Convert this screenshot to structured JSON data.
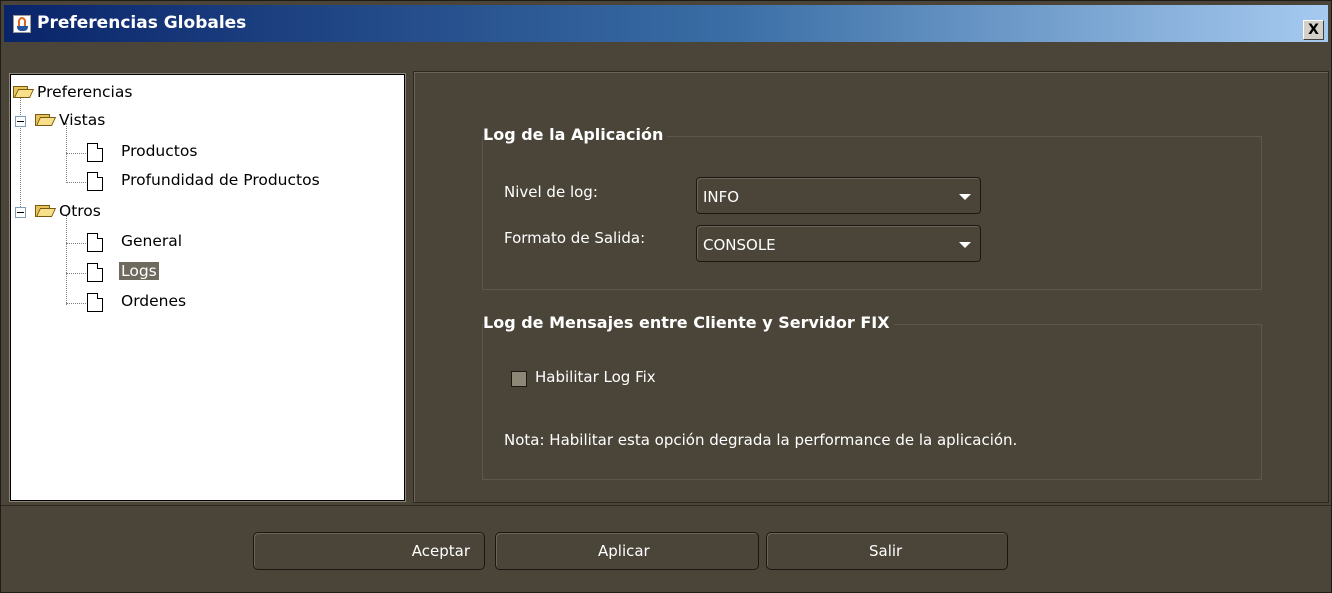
{
  "window": {
    "title": "Preferencias Globales",
    "close_label": "X"
  },
  "tree": {
    "root": "Preferencias",
    "vistas": "Vistas",
    "productos": "Productos",
    "profundidad": "Profundidad de Productos",
    "otros": "Otros",
    "general": "General",
    "logs": "Logs",
    "ordenes": "Ordenes",
    "selected": "Logs"
  },
  "app_log": {
    "title": "Log de la Aplicación",
    "level_label": "Nivel de log:",
    "level_value": "INFO",
    "format_label": "Formato de Salida:",
    "format_value": "CONSOLE"
  },
  "fix_log": {
    "title": "Log de Mensajes entre Cliente y Servidor FIX",
    "checkbox_label": "Habilitar Log Fix",
    "checked": false,
    "note": "Nota: Habilitar esta opción degrada la performance de la aplicación."
  },
  "buttons": {
    "accept": "Aceptar",
    "apply": "Aplicar",
    "exit": "Salir"
  },
  "colors": {
    "background": "#4a4538",
    "title_gradient_start": "#0a246a",
    "title_gradient_end": "#a6caf0",
    "selection": "#6e6a5e"
  }
}
